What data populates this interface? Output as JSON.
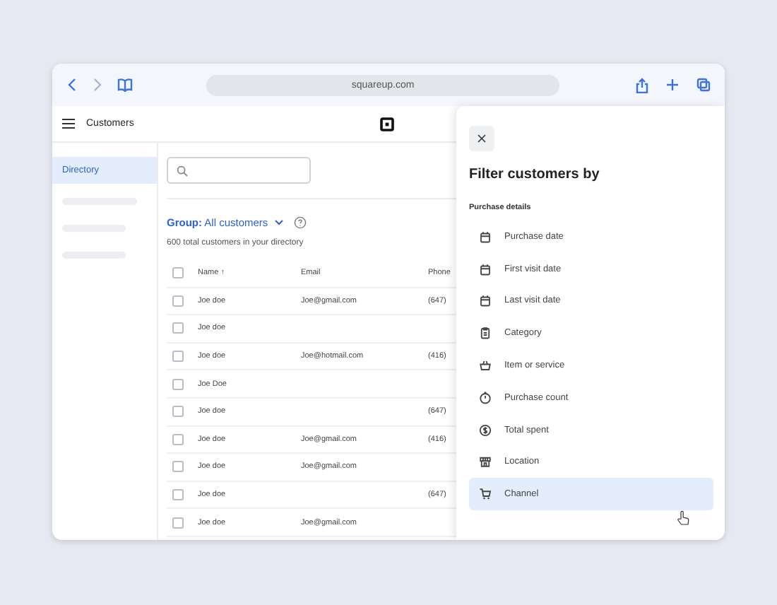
{
  "browser": {
    "url": "squareup.com"
  },
  "header": {
    "title": "Customers"
  },
  "sidebar": {
    "items": [
      {
        "label": "Directory",
        "selected": true
      }
    ]
  },
  "main": {
    "group_label": "Group:",
    "group_value": "All customers",
    "summary": "600 total customers in your directory"
  },
  "table": {
    "select_all_checked": false,
    "columns": [
      "Name ↑",
      "Email",
      "Phone"
    ],
    "rows": [
      {
        "name": "Joe doe",
        "email": "Joe@gmail.com",
        "phone": "(647)",
        "checked": false
      },
      {
        "name": "Joe doe",
        "email": "",
        "phone": "",
        "checked": false
      },
      {
        "name": "Joe doe",
        "email": "Joe@hotmail.com",
        "phone": "(416)",
        "checked": false
      },
      {
        "name": "Joe Doe",
        "email": "",
        "phone": "",
        "checked": false
      },
      {
        "name": "Joe doe",
        "email": "",
        "phone": "(647)",
        "checked": false
      },
      {
        "name": "Joe doe",
        "email": "Joe@gmail.com",
        "phone": "(416)",
        "checked": false
      },
      {
        "name": "Joe doe",
        "email": "Joe@gmail.com",
        "phone": "",
        "checked": false
      },
      {
        "name": "Joe doe",
        "email": "",
        "phone": "(647)",
        "checked": false
      },
      {
        "name": "Joe doe",
        "email": "Joe@gmail.com",
        "phone": "",
        "checked": false
      }
    ]
  },
  "filter_panel": {
    "title": "Filter customers by",
    "section": "Purchase details",
    "items": [
      {
        "label": "Purchase date",
        "selected": false
      },
      {
        "label": "First visit date",
        "selected": false
      },
      {
        "label": "Last visit date",
        "selected": false
      },
      {
        "label": "Category",
        "selected": false
      },
      {
        "label": "Item or service",
        "selected": false
      },
      {
        "label": "Purchase count",
        "selected": false
      },
      {
        "label": "Total spent",
        "selected": false
      },
      {
        "label": "Location",
        "selected": false
      },
      {
        "label": "Channel",
        "selected": true
      }
    ]
  }
}
